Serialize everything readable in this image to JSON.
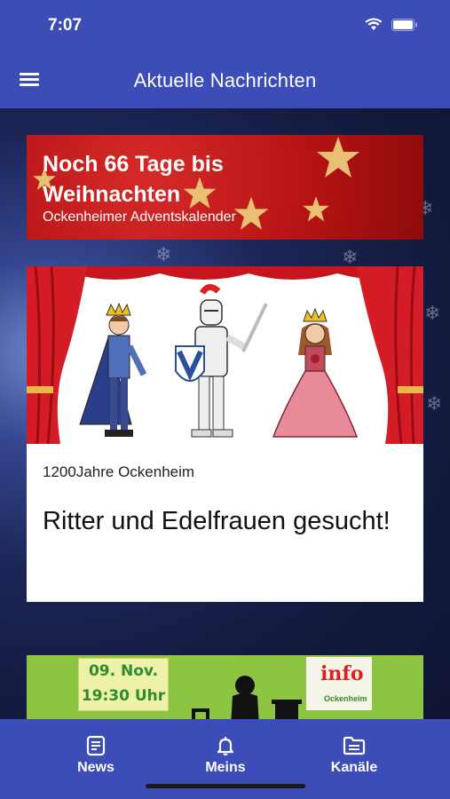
{
  "status": {
    "time": "7:07"
  },
  "appbar": {
    "title": "Aktuelle Nachrichten"
  },
  "advent": {
    "title": "Noch 66 Tage bis Weihnachten",
    "subtitle": "Ockenheimer Adventskalender"
  },
  "news_card": {
    "category": "1200Jahre Ockenheim",
    "headline": "Ritter und Edelfrauen gesucht!"
  },
  "event_card": {
    "date_line1": "09. Nov.",
    "date_line2": "19:30 Uhr",
    "info_label": "info",
    "info_sub": "Ockenheim"
  },
  "tabs": [
    {
      "label": "News",
      "icon": "newspaper-icon"
    },
    {
      "label": "Meins",
      "icon": "bell-icon"
    },
    {
      "label": "Kanäle",
      "icon": "folder-icon"
    }
  ],
  "colors": {
    "primary": "#3d4db7",
    "banner_red": "#b81414",
    "event_green": "#8dc542"
  }
}
